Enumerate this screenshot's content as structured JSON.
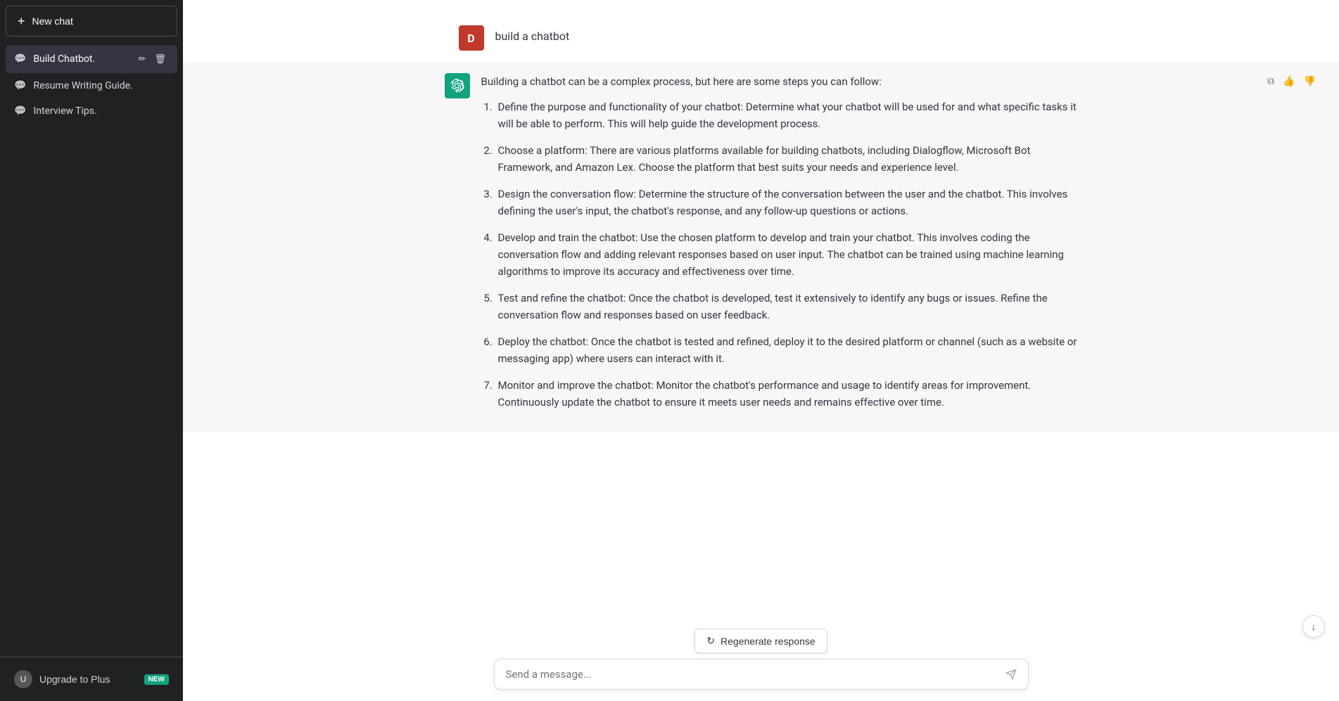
{
  "sidebar": {
    "new_chat_label": "New chat",
    "new_chat_plus": "+",
    "items": [
      {
        "id": "build-chatbot",
        "label": "Build Chatbot.",
        "active": true
      },
      {
        "id": "resume-writing",
        "label": "Resume Writing Guide.",
        "active": false
      },
      {
        "id": "interview-tips",
        "label": "Interview Tips.",
        "active": false
      }
    ],
    "edit_icon": "✏",
    "delete_icon": "🗑",
    "footer": {
      "upgrade_label": "Upgrade to Plus",
      "new_badge": "NEW",
      "avatar_letter": "U"
    }
  },
  "chat": {
    "user_avatar_letter": "D",
    "user_message": "build a chatbot",
    "assistant_intro": "Building a chatbot can be a complex process, but here are some steps you can follow:",
    "steps": [
      {
        "num": 1,
        "text": "Define the purpose and functionality of your chatbot: Determine what your chatbot will be used for and what specific tasks it will be able to perform. This will help guide the development process."
      },
      {
        "num": 2,
        "text": "Choose a platform: There are various platforms available for building chatbots, including Dialogflow, Microsoft Bot Framework, and Amazon Lex. Choose the platform that best suits your needs and experience level."
      },
      {
        "num": 3,
        "text": "Design the conversation flow: Determine the structure of the conversation between the user and the chatbot. This involves defining the user's input, the chatbot's response, and any follow-up questions or actions."
      },
      {
        "num": 4,
        "text": "Develop and train the chatbot: Use the chosen platform to develop and train your chatbot. This involves coding the conversation flow and adding relevant responses based on user input. The chatbot can be trained using machine learning algorithms to improve its accuracy and effectiveness over time."
      },
      {
        "num": 5,
        "text": "Test and refine the chatbot: Once the chatbot is developed, test it extensively to identify any bugs or issues. Refine the conversation flow and responses based on user feedback."
      },
      {
        "num": 6,
        "text": "Deploy the chatbot: Once the chatbot is tested and refined, deploy it to the desired platform or channel (such as a website or messaging app) where users can interact with it."
      },
      {
        "num": 7,
        "text": "Monitor and improve the chatbot: Monitor the chatbot's performance and usage to identify areas for improvement. Continuously update the chatbot to ensure it meets user needs and remains effective over time."
      }
    ]
  },
  "input": {
    "placeholder": "Send a message...",
    "send_icon": "▷"
  },
  "regenerate": {
    "label": "Regenerate response",
    "icon": "↻"
  },
  "icons": {
    "copy": "⧉",
    "thumbs_up": "👍",
    "thumbs_down": "👎",
    "chat_bubble": "💬",
    "scroll_down": "↓"
  }
}
